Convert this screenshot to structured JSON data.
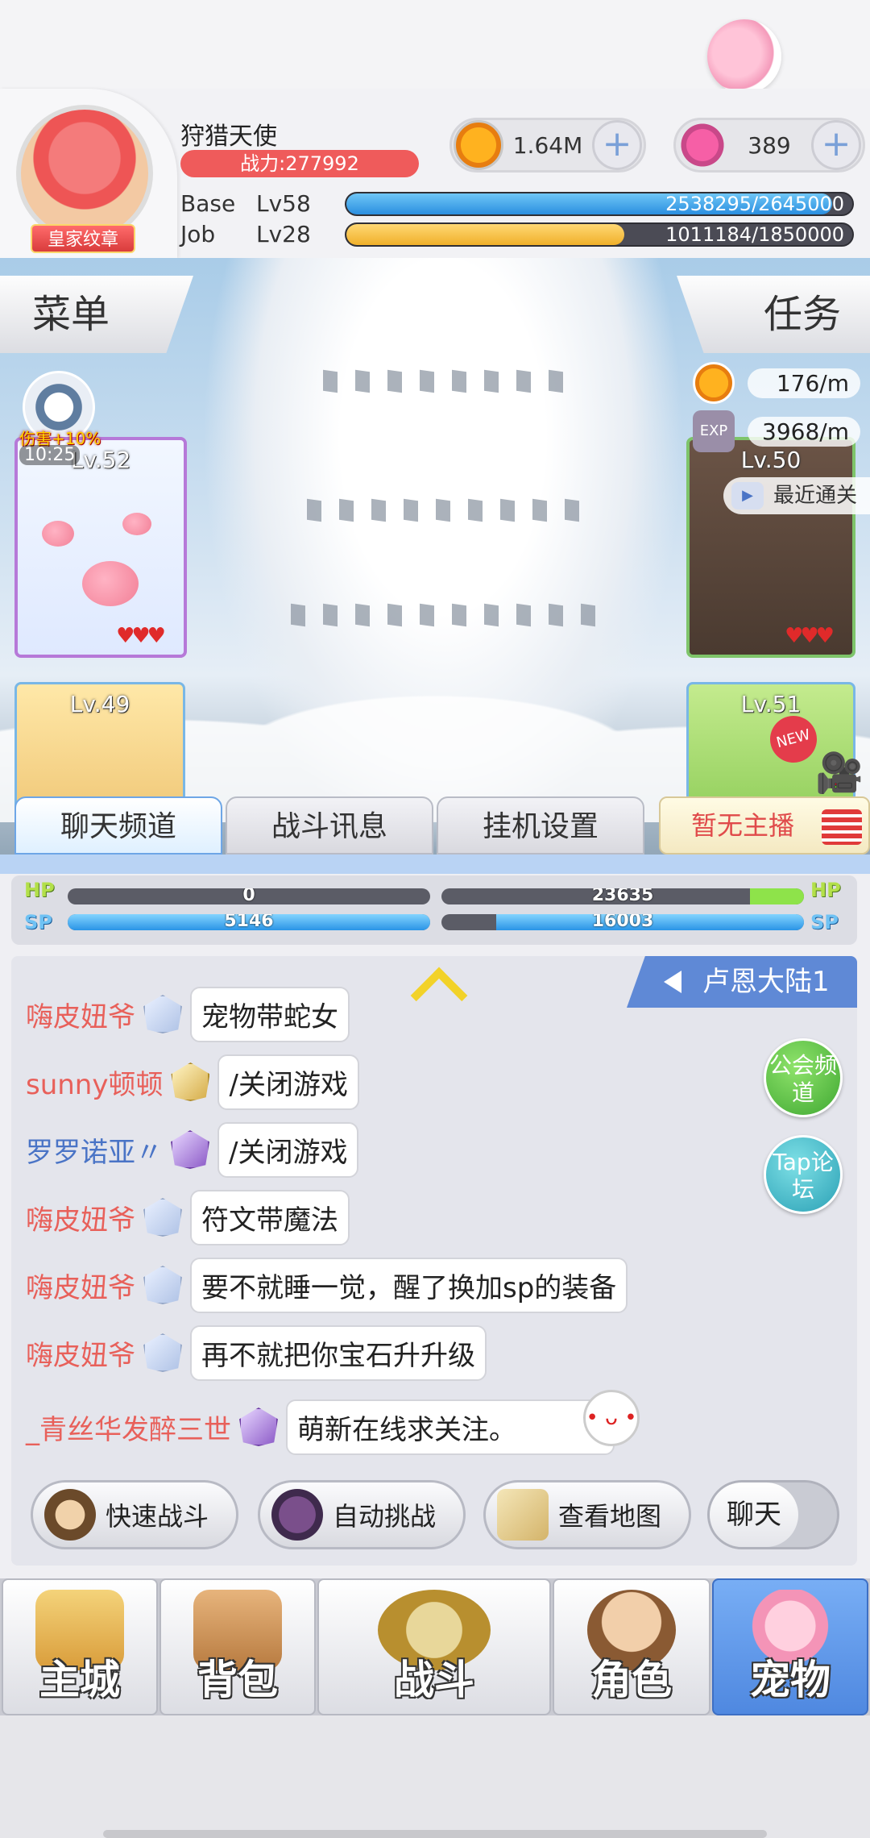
{
  "header": {
    "avatar_badge": "皇家纹章",
    "player_name": "狩猎天使",
    "power": "战力:277992",
    "zeny": "1.64M",
    "gems": "389",
    "plus": "+",
    "base_label": "Base",
    "base_level": "Lv58",
    "base_exp": "2538295/2645000",
    "base_fill": 0.96,
    "job_label": "Job",
    "job_level": "Lv28",
    "job_exp": "1011184/1850000",
    "job_fill": 0.55
  },
  "scene": {
    "menu": "菜单",
    "quest": "任务",
    "buff_label": "伤害+10%",
    "buff_time": "10:25",
    "zeny_rate": "176/m",
    "exp_icon": "EXP",
    "exp_rate": "3968/m",
    "recent_clear": "最近通关",
    "new_badge": "NEW",
    "stages": [
      {
        "level": "Lv.52",
        "hearts": "♥♥♥"
      },
      {
        "level": "Lv.50",
        "hearts": "♥♥♥"
      },
      {
        "level": "Lv.49"
      },
      {
        "level": "Lv.51"
      }
    ]
  },
  "chat_tabs": {
    "tab1": "聊天频道",
    "tab2": "战斗讯息",
    "tab3": "挂机设置",
    "anchor": "暂无主播"
  },
  "stats": {
    "hp_tag": "HP",
    "sp_tag": "SP",
    "self_hp": "0",
    "self_sp": "5146",
    "enemy_hp": "23635",
    "enemy_sp": "16003",
    "self_hp_fill": 0.0,
    "self_sp_fill": 1.0,
    "enemy_hp_fill": 0.15,
    "enemy_sp_fill": 0.85
  },
  "chat": {
    "region": "卢恩大陆1",
    "guild_btn": "公会频道",
    "tap_btn": "Tap论坛",
    "messages": [
      {
        "name": "嗨皮妞爷",
        "text": "宠物带蛇女",
        "color": "#e8605a"
      },
      {
        "name": "sunny顿顿",
        "text": "/关闭游戏",
        "color": "#e8605a"
      },
      {
        "name": "罗罗诺亚〃",
        "text": "/关闭游戏",
        "color": "#4a74c6"
      },
      {
        "name": "嗨皮妞爷",
        "text": "符文带魔法",
        "color": "#e8605a"
      },
      {
        "name": "嗨皮妞爷",
        "text": "要不就睡一觉，醒了换加sp的装备",
        "color": "#e8605a"
      },
      {
        "name": "嗨皮妞爷",
        "text": "再不就把你宝石升升级",
        "color": "#e8605a"
      },
      {
        "name": "_青丝华发醉三世",
        "text": "萌新在线求关注。",
        "color": "#e8605a"
      }
    ],
    "quick_battle": "快速战斗",
    "auto_challenge": "自动挑战",
    "view_map": "查看地图",
    "chat_toggle": "聊天"
  },
  "nav": {
    "home": "主城",
    "bag": "背包",
    "battle": "战斗",
    "role": "角色",
    "pet": "宠物"
  }
}
